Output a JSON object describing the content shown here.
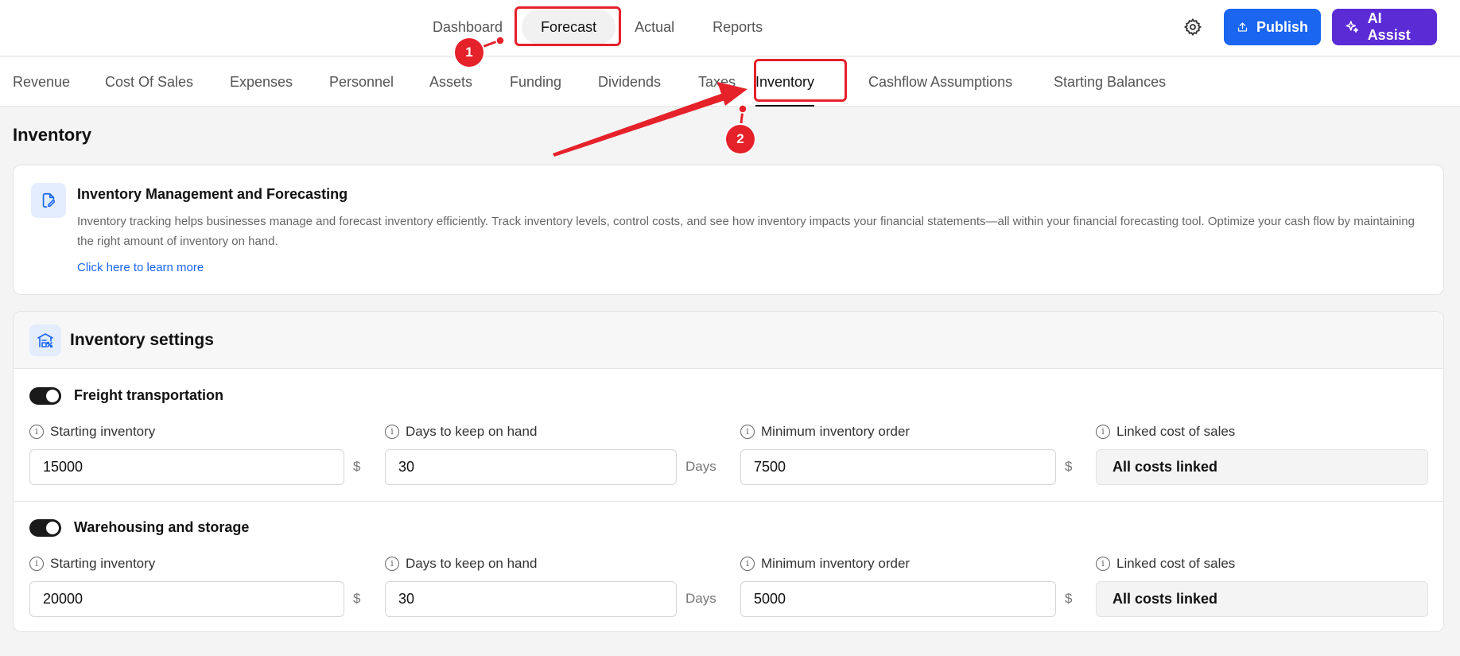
{
  "topnav": {
    "items": [
      "Dashboard",
      "Forecast",
      "Actual",
      "Reports"
    ],
    "active": "Forecast",
    "publish_label": "Publish",
    "ai_assist_label": "AI Assist"
  },
  "subtabs": {
    "items": [
      "Revenue",
      "Cost Of Sales",
      "Expenses",
      "Personnel",
      "Assets",
      "Funding",
      "Dividends",
      "Taxes",
      "Inventory",
      "Cashflow Assumptions",
      "Starting Balances"
    ],
    "active": "Inventory"
  },
  "page_title": "Inventory",
  "info": {
    "icon": "document-edit-icon",
    "title": "Inventory Management and Forecasting",
    "text": "Inventory tracking helps businesses manage and forecast inventory efficiently. Track inventory levels, control costs, and see how inventory impacts your financial statements—all within your financial forecasting tool. Optimize your cash flow by maintaining the right amount of inventory on hand.",
    "link": "Click here to learn more"
  },
  "settings": {
    "title": "Inventory settings",
    "icon": "warehouse-percent-icon",
    "sections": [
      {
        "name": "Freight transportation",
        "enabled": true,
        "starting_inventory_label": "Starting inventory",
        "starting_inventory": "15000",
        "starting_inventory_unit": "$",
        "days_label": "Days to keep on hand",
        "days": "30",
        "days_unit": "Days",
        "min_order_label": "Minimum inventory order",
        "min_order": "7500",
        "min_order_unit": "$",
        "linked_label": "Linked cost of sales",
        "linked": "All costs linked"
      },
      {
        "name": "Warehousing and storage",
        "enabled": true,
        "starting_inventory_label": "Starting inventory",
        "starting_inventory": "20000",
        "starting_inventory_unit": "$",
        "days_label": "Days to keep on hand",
        "days": "30",
        "days_unit": "Days",
        "min_order_label": "Minimum inventory order",
        "min_order": "5000",
        "min_order_unit": "$",
        "linked_label": "Linked cost of sales",
        "linked": "All costs linked"
      }
    ]
  },
  "annotations": {
    "marker_1": "1",
    "marker_2": "2",
    "color": "#e5212a"
  },
  "colors": {
    "primary": "#1a66f0",
    "ai": "#5b2bd6"
  }
}
